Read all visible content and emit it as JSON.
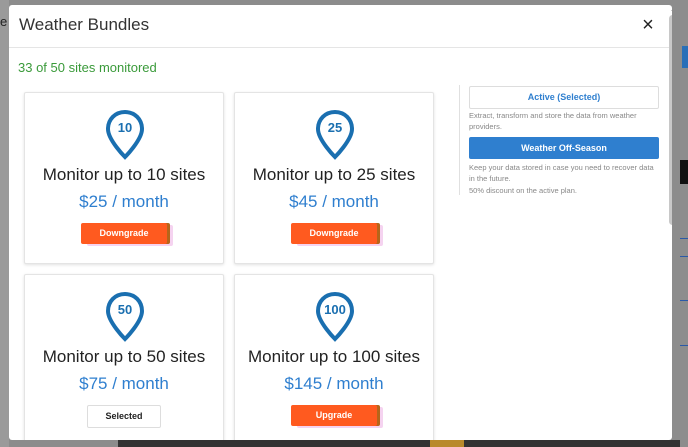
{
  "background": {
    "left_fragment": "e"
  },
  "modal": {
    "title": "Weather Bundles",
    "close_symbol": "×",
    "sites_monitored": "33 of 50 sites monitored"
  },
  "plans": [
    {
      "pin": "10",
      "title": "Monitor up to 10 sites",
      "price": "$25 / month",
      "button": "Downgrade"
    },
    {
      "pin": "25",
      "title": "Monitor up to 25 sites",
      "price": "$45 / month",
      "button": "Downgrade"
    },
    {
      "pin": "50",
      "title": "Monitor up to 50 sites",
      "price": "$75 / month",
      "button": "Selected"
    },
    {
      "pin": "100",
      "title": "Monitor up to 100 sites",
      "price": "$145 / month",
      "button": "Upgrade"
    }
  ],
  "right_panel": {
    "active_label": "Active (Selected)",
    "active_desc": "Extract, transform and store the data from weather providers.",
    "offseason_label": "Weather Off-Season",
    "offseason_desc": "Keep your data stored in case you need to recover data in the future.",
    "offseason_discount": "50% discount on the active plan."
  },
  "colors": {
    "accent_blue": "#2f7fcf",
    "orange_button": "#ff5a1f",
    "green_text": "#3a9a3a"
  },
  "icons": {
    "pin": "map-pin-icon",
    "close": "close-icon"
  }
}
